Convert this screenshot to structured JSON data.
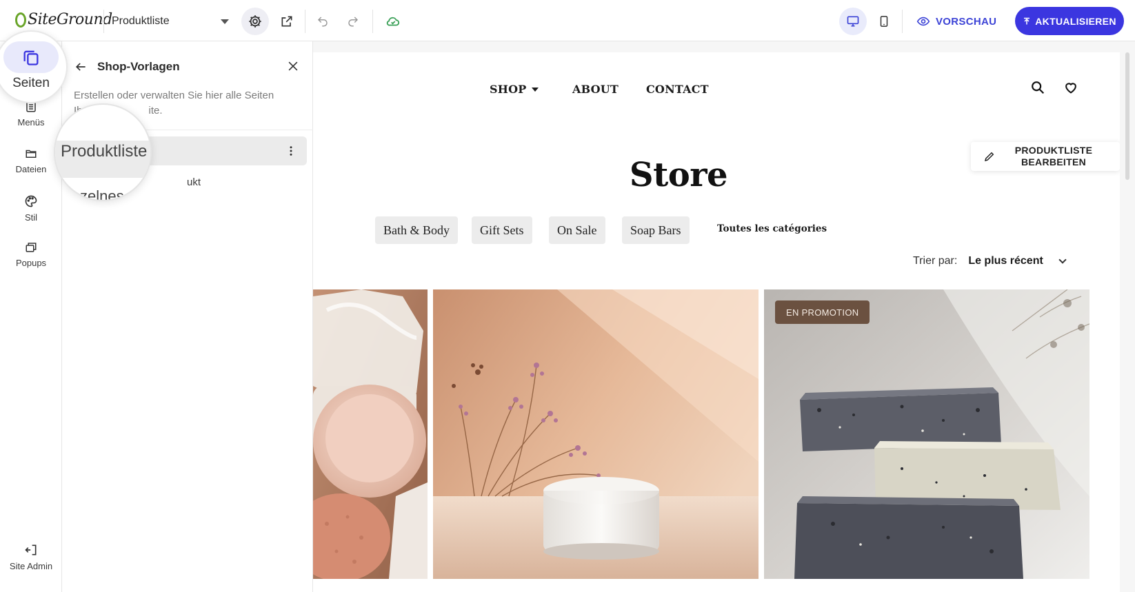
{
  "app": {
    "brand": "SiteGround",
    "page_selector": "Produktliste",
    "preview_label": "VORSCHAU",
    "update_label": "AKTUALISIEREN"
  },
  "rail": {
    "items": [
      {
        "label": "Seiten",
        "icon": "pages-icon",
        "active": true
      },
      {
        "label": "Menüs",
        "icon": "menu-list-icon"
      },
      {
        "label": "Dateien",
        "icon": "folder-icon"
      },
      {
        "label": "Stil",
        "icon": "palette-icon"
      },
      {
        "label": "Popups",
        "icon": "popups-icon"
      }
    ],
    "site_admin": "Site Admin"
  },
  "panel": {
    "title": "Shop-Vorlagen",
    "description_visible": "Erstellen oder verwalten Sie hier alle Seiten",
    "description_line2_fragment_a": "Ih",
    "description_line2_fragment_b": "ite.",
    "items": [
      {
        "label": "Produktliste",
        "active": true
      },
      {
        "label": "ukt",
        "magnified_fragment": "zelnes"
      }
    ]
  },
  "site": {
    "nav": [
      {
        "label": "SHOP",
        "dropdown": true
      },
      {
        "label": "ABOUT"
      },
      {
        "label": "CONTACT"
      }
    ],
    "edit_chip": "PRODUKTLISTE BEARBEITEN",
    "title": "Store",
    "categories": [
      "Bath & Body",
      "Gift Sets",
      "On Sale",
      "Soap Bars"
    ],
    "all_categories": "Toutes les catégories",
    "sort_label": "Trier par:",
    "sort_value": "Le plus récent",
    "promo_badge": "EN PROMOTION"
  },
  "colors": {
    "accent": "#3b36e0",
    "accent_text": "#3c43d6",
    "brand_green": "#6aa52a",
    "promo_bg": "#6b5140"
  }
}
